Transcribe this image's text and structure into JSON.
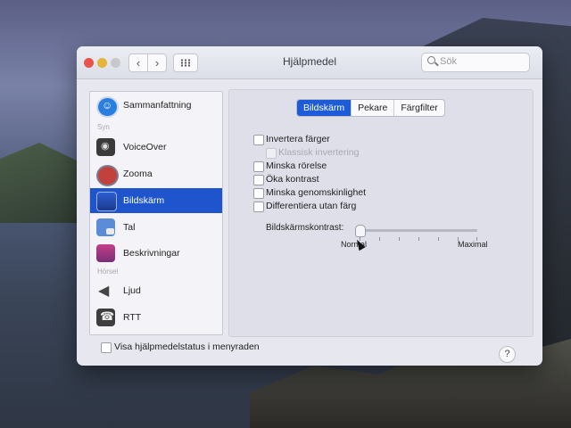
{
  "window": {
    "title": "Hjälpmedel"
  },
  "toolbar": {
    "back_icon": "‹",
    "forward_icon": "›",
    "search_placeholder": "Sök"
  },
  "sidebar": {
    "items": [
      {
        "label": "Sammanfattning",
        "icon": "accessibility-icon"
      },
      {
        "label": "VoiceOver",
        "icon": "voiceover-icon"
      },
      {
        "label": "Zooma",
        "icon": "zoom-icon"
      },
      {
        "label": "Bildskärm",
        "icon": "display-icon",
        "selected": true
      },
      {
        "label": "Tal",
        "icon": "speech-icon"
      },
      {
        "label": "Beskrivningar",
        "icon": "descriptions-icon"
      },
      {
        "label": "Ljud",
        "icon": "speaker-icon"
      },
      {
        "label": "RTT",
        "icon": "rtt-icon"
      }
    ],
    "groups": [
      "Syn",
      "Hörsel"
    ]
  },
  "tabs": {
    "items": [
      "Bildskärm",
      "Pekare",
      "Färgfilter"
    ],
    "active": "Bildskärm"
  },
  "options": [
    {
      "label": "Invertera färger",
      "checked": false
    },
    {
      "label": "Klassisk invertering",
      "checked": false,
      "disabled": true
    },
    {
      "label": "Minska rörelse",
      "checked": false
    },
    {
      "label": "Öka kontrast",
      "checked": false
    },
    {
      "label": "Minska genomskinlighet",
      "checked": false
    },
    {
      "label": "Differentiera utan färg",
      "checked": false
    }
  ],
  "contrast": {
    "label": "Bildskärmskontrast:",
    "min_label": "Normal",
    "max_label": "Maximal",
    "value": 0
  },
  "footer": {
    "status_label": "Visa hjälpmedelstatus i menyraden",
    "help_label": "?"
  },
  "colors": {
    "accent": "#1e55cc",
    "close": "#e8544b",
    "minimize": "#e4b53a"
  }
}
